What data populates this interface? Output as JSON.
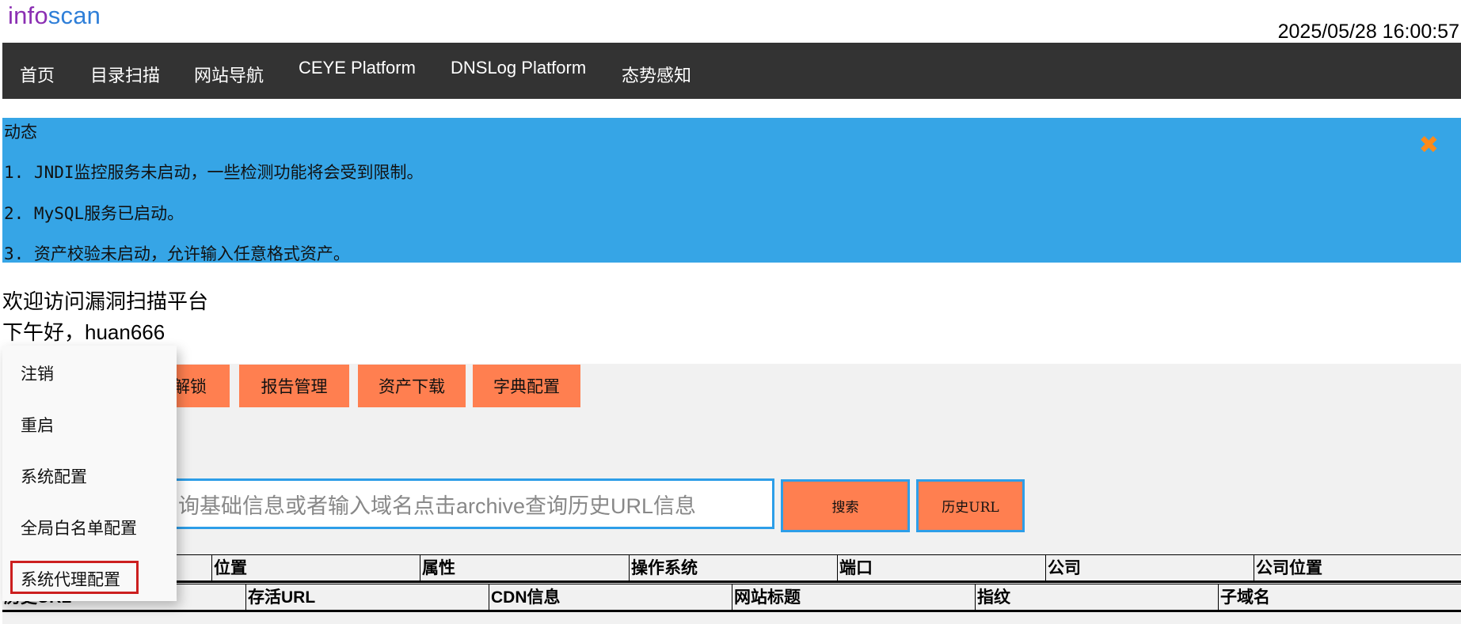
{
  "header": {
    "logo_part1": "info",
    "logo_part2": "scan",
    "datetime": "2025/05/28 16:00:57"
  },
  "nav": {
    "items": [
      {
        "label": "首页"
      },
      {
        "label": "目录扫描"
      },
      {
        "label": "网站导航"
      },
      {
        "label": "CEYE Platform"
      },
      {
        "label": "DNSLog Platform"
      },
      {
        "label": "态势感知"
      }
    ]
  },
  "notice": {
    "title": "动态",
    "lines": [
      "1. JNDI监控服务未启动，一些检测功能将会受到限制。",
      "2. MySQL服务已启动。",
      "3. 资产校验未启动，允许输入任意格式资产。"
    ],
    "close_icon": "close-x-icon"
  },
  "welcome": {
    "title": "欢迎访问漏洞扫描平台",
    "greeting": "下午好，huan666"
  },
  "toolbar": {
    "buttons": [
      {
        "label": "解锁"
      },
      {
        "label": "报告管理"
      },
      {
        "label": "资产下载"
      },
      {
        "label": "字典配置"
      }
    ]
  },
  "search": {
    "placeholder": "询基础信息或者输入域名点击archive查询历史URL信息",
    "search_label": "搜索",
    "history_label": "历史URL"
  },
  "table1": {
    "headers": [
      "",
      "位置",
      "属性",
      "操作系统",
      "端口",
      "公司",
      "公司位置"
    ]
  },
  "table2": {
    "headers": [
      "历史URL",
      "存活URL",
      "CDN信息",
      "网站标题",
      "指纹",
      "子域名"
    ]
  },
  "dropdown": {
    "items": [
      {
        "label": "注销"
      },
      {
        "label": "重启"
      },
      {
        "label": "系统配置"
      },
      {
        "label": "全局白名单配置"
      },
      {
        "label": "系统代理配置"
      }
    ]
  },
  "colors": {
    "nav_bg": "#333333",
    "notice_bg": "#36a5e6",
    "button_orange": "#ff7f50",
    "highlight_red": "#cc1f1f"
  }
}
